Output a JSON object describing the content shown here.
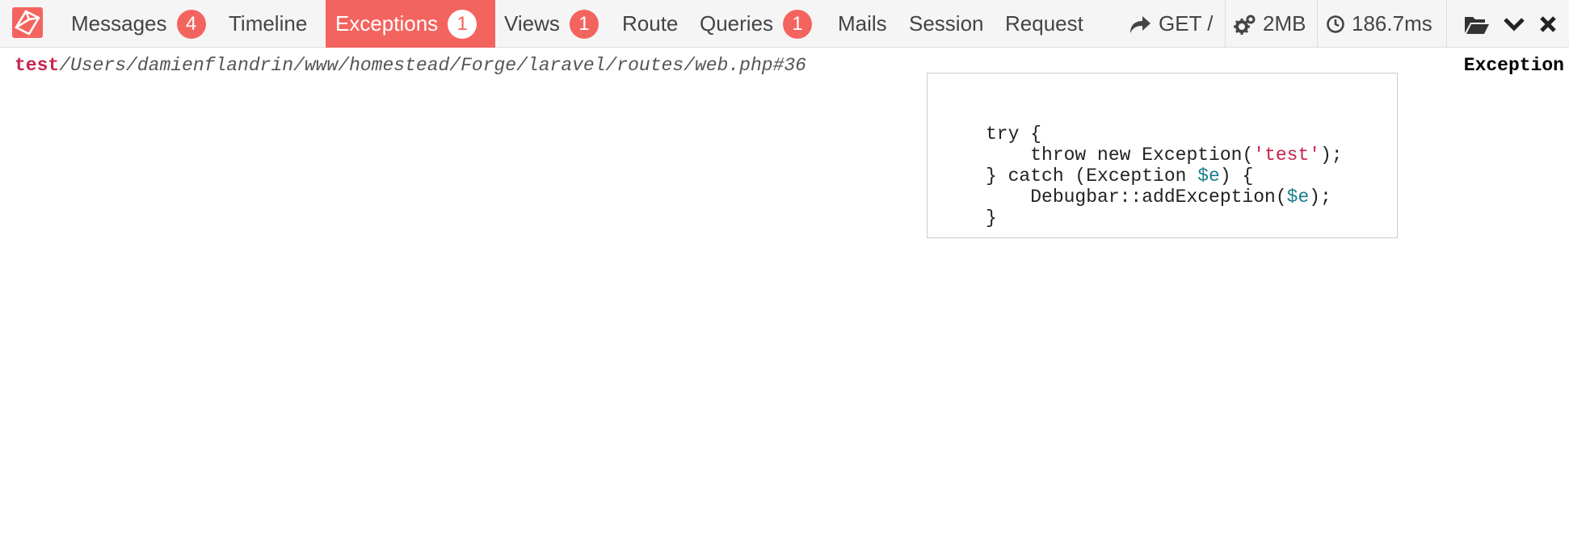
{
  "toolbar": {
    "tabs": [
      {
        "label": "Messages",
        "badge": "4"
      },
      {
        "label": "Timeline"
      },
      {
        "label": "Exceptions",
        "badge": "1",
        "active": true
      },
      {
        "label": "Views",
        "badge": "1"
      },
      {
        "label": "Route"
      },
      {
        "label": "Queries",
        "badge": "1"
      },
      {
        "label": "Mails"
      },
      {
        "label": "Session"
      },
      {
        "label": "Request"
      }
    ],
    "indicators": {
      "request": "GET /",
      "memory": "2MB",
      "time": "186.7ms"
    },
    "icons": {
      "logo": "laravel-logo-icon",
      "request": "share-arrow-icon",
      "memory": "gears-icon",
      "time": "clock-icon",
      "open": "folder-open-icon",
      "minimize": "chevron-down-icon",
      "close": "close-icon"
    }
  },
  "exception": {
    "message": "test",
    "file": "/Users/damienflandrin/www/homestead/Forge/laravel/routes/web.php#36",
    "type": "Exception",
    "code": {
      "l1": "try {",
      "l2a": "    throw new Exception(",
      "l2b": "'test'",
      "l2c": ");",
      "l3a": "} catch (Exception ",
      "l3b": "$e",
      "l3c": ") {",
      "l4a": "    Debugbar::addException(",
      "l4b": "$e",
      "l4c": ");",
      "l5": "}"
    }
  },
  "colors": {
    "accent": "#f4645f",
    "toolbar_bg": "#f5f5f5",
    "string": "#c7254e",
    "variable": "#1a7d8a"
  }
}
